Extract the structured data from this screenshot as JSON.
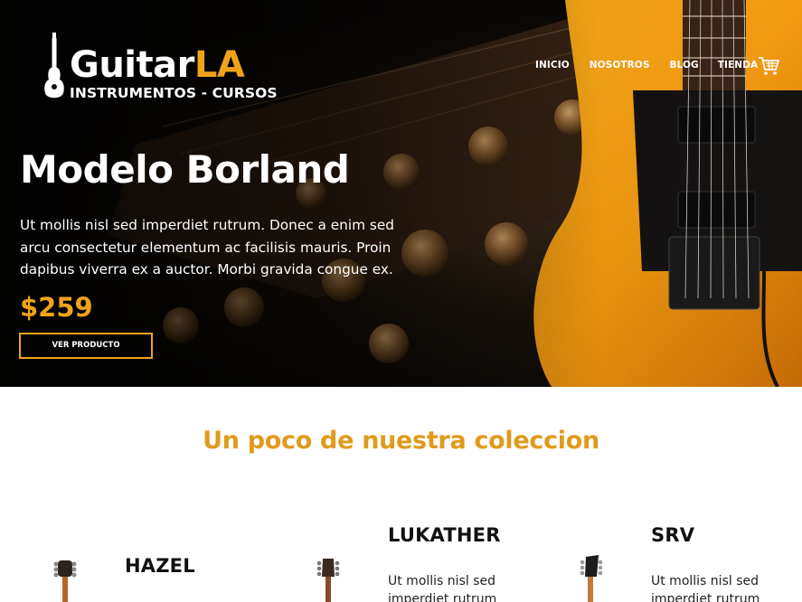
{
  "brand": {
    "name_part1": "Guitar",
    "name_part2": "LA",
    "tagline": "INSTRUMENTOS - CURSOS",
    "accent_color": "#f0a31a"
  },
  "nav": {
    "items": [
      "INICIO",
      "NOSOTROS",
      "BLOG",
      "TIENDA"
    ],
    "cart_icon": "shopping-cart-icon"
  },
  "hero": {
    "title": "Modelo Borland",
    "description": "Ut mollis nisl sed imperdiet rutrum. Donec a enim sed arcu consectetur elementum ac facilisis mauris. Proin dapibus viverra ex a auctor. Morbi gravida congue ex.",
    "price": "$259",
    "button_label": "VER PRODUCTO"
  },
  "collection": {
    "title": "Un poco de nuestra coleccion",
    "title_color": "#e09a1c",
    "products": [
      {
        "name": "HAZEL",
        "description": ""
      },
      {
        "name": "LUKATHER",
        "description": "Ut mollis nisl sed imperdiet rutrum"
      },
      {
        "name": "SRV",
        "description": "Ut mollis nisl sed imperdiet rutrum"
      }
    ]
  }
}
